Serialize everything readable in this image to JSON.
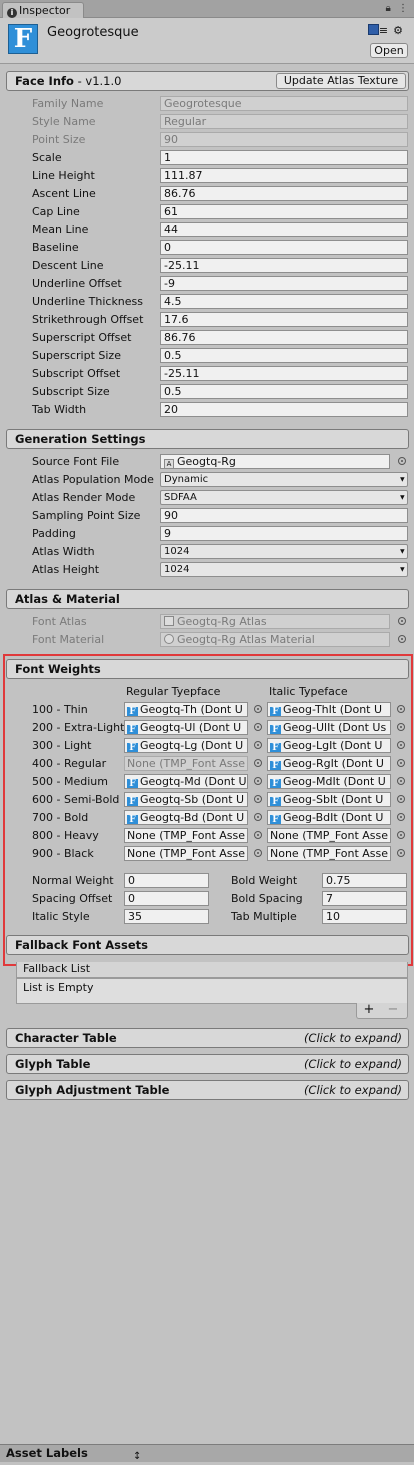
{
  "tab": {
    "title": "Inspector"
  },
  "header": {
    "asset_name": "Geogrotesque",
    "icon_letter": "F",
    "open_label": "Open"
  },
  "face_info": {
    "title": "Face Info",
    "version": " - v1.1.0",
    "update_button": "Update Atlas Texture",
    "rows": [
      {
        "label": "Family Name",
        "value": "Geogrotesque",
        "disabled": true
      },
      {
        "label": "Style Name",
        "value": "Regular",
        "disabled": true
      },
      {
        "label": "Point Size",
        "value": "90",
        "disabled": true
      },
      {
        "label": "Scale",
        "value": "1"
      },
      {
        "label": "Line Height",
        "value": "111.87"
      },
      {
        "label": "Ascent Line",
        "value": "86.76"
      },
      {
        "label": "Cap Line",
        "value": "61"
      },
      {
        "label": "Mean Line",
        "value": "44"
      },
      {
        "label": "Baseline",
        "value": "0"
      },
      {
        "label": "Descent Line",
        "value": "-25.11"
      },
      {
        "label": "Underline Offset",
        "value": "-9"
      },
      {
        "label": "Underline Thickness",
        "value": "4.5"
      },
      {
        "label": "Strikethrough Offset",
        "value": "17.6"
      },
      {
        "label": "Superscript Offset",
        "value": "86.76"
      },
      {
        "label": "Superscript Size",
        "value": "0.5"
      },
      {
        "label": "Subscript Offset",
        "value": "-25.11"
      },
      {
        "label": "Subscript Size",
        "value": "0.5"
      },
      {
        "label": "Tab Width",
        "value": "20"
      }
    ]
  },
  "generation": {
    "title": "Generation Settings",
    "source_font_file": {
      "label": "Source Font File",
      "value": "Geogtq-Rg"
    },
    "population_mode": {
      "label": "Atlas Population Mode",
      "value": "Dynamic"
    },
    "render_mode": {
      "label": "Atlas Render Mode",
      "value": "SDFAA"
    },
    "sampling_point_size": {
      "label": "Sampling Point Size",
      "value": "90"
    },
    "padding": {
      "label": "Padding",
      "value": "9"
    },
    "atlas_width": {
      "label": "Atlas Width",
      "value": "1024"
    },
    "atlas_height": {
      "label": "Atlas Height",
      "value": "1024"
    }
  },
  "atlas_material": {
    "title": "Atlas & Material",
    "font_atlas": {
      "label": "Font Atlas",
      "value": "Geogtq-Rg  Atlas"
    },
    "font_material": {
      "label": "Font Material",
      "value": "Geogtq-Rg  Atlas Material"
    }
  },
  "font_weights": {
    "title": "Font Weights",
    "regular_header": "Regular Tyepface",
    "italic_header": "Italic Typeface",
    "rows": [
      {
        "label": "100 - Thin",
        "regular": "Geogtq-Th (Dont U",
        "italic": "Geog-ThIt (Dont U",
        "reg_none": false,
        "ita_none": false
      },
      {
        "label": "200 - Extra-Light",
        "regular": "Geogtq-Ul (Dont U",
        "italic": "Geog-UlIt (Dont Us",
        "reg_none": false,
        "ita_none": false
      },
      {
        "label": "300 - Light",
        "regular": "Geogtq-Lg (Dont U",
        "italic": "Geog-LgIt (Dont U",
        "reg_none": false,
        "ita_none": false
      },
      {
        "label": "400 - Regular",
        "regular": "None (TMP_Font Asse",
        "italic": "Geog-RgIt (Dont U",
        "reg_none": true,
        "reg_disabled": true,
        "ita_none": false
      },
      {
        "label": "500 - Medium",
        "regular": "Geogtq-Md (Dont U",
        "italic": "Geog-MdIt (Dont U",
        "reg_none": false,
        "ita_none": false
      },
      {
        "label": "600 - Semi-Bold",
        "regular": "Geogtq-Sb (Dont U",
        "italic": "Geog-SbIt (Dont U",
        "reg_none": false,
        "ita_none": false
      },
      {
        "label": "700 - Bold",
        "regular": "Geogtq-Bd (Dont U",
        "italic": "Geog-BdIt (Dont U",
        "reg_none": false,
        "ita_none": false
      },
      {
        "label": "800 - Heavy",
        "regular": "None (TMP_Font Asse",
        "italic": "None (TMP_Font Asse",
        "reg_none": true,
        "ita_none": true
      },
      {
        "label": "900 - Black",
        "regular": "None (TMP_Font Asse",
        "italic": "None (TMP_Font Asse",
        "reg_none": true,
        "ita_none": true
      }
    ],
    "normal_weight": {
      "label": "Normal Weight",
      "value": "0"
    },
    "bold_weight": {
      "label": "Bold Weight",
      "value": "0.75"
    },
    "spacing_offset": {
      "label": "Spacing Offset",
      "value": "0"
    },
    "bold_spacing": {
      "label": "Bold Spacing",
      "value": "7"
    },
    "italic_style": {
      "label": "Italic Style",
      "value": "35"
    },
    "tab_multiple": {
      "label": "Tab Multiple",
      "value": "10"
    }
  },
  "fallback": {
    "title": "Fallback Font Assets",
    "list_header": "Fallback List",
    "empty_text": "List is Empty",
    "add": "+",
    "remove": "−"
  },
  "collapsed_sections": [
    {
      "title": "Character Table",
      "hint": "(Click to expand)"
    },
    {
      "title": "Glyph Table",
      "hint": "(Click to expand)"
    },
    {
      "title": "Glyph Adjustment Table",
      "hint": "(Click to expand)"
    }
  ],
  "asset_labels": {
    "title": "Asset Labels"
  }
}
